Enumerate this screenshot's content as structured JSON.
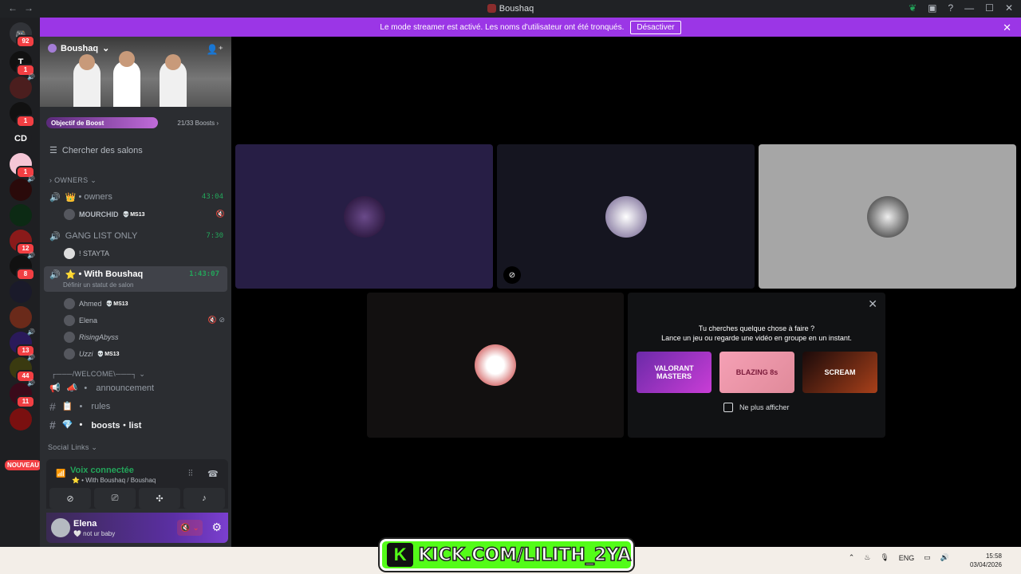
{
  "window": {
    "title": "Boushaq",
    "back": "←",
    "forward": "→"
  },
  "banner": {
    "text": "Le mode streamer est activé. Les noms d'utilisateur ont été tronqués.",
    "button": "Désactiver",
    "close": "✕"
  },
  "guilds": [
    {
      "label": "",
      "badge": "92"
    },
    {
      "label": "T",
      "badge": "1"
    },
    {
      "label": "",
      "badge": ""
    },
    {
      "label": "",
      "badge": "1"
    },
    {
      "label": "CD",
      "badge": ""
    },
    {
      "label": "",
      "badge": "1"
    },
    {
      "label": "",
      "badge": ""
    },
    {
      "label": "",
      "badge": ""
    },
    {
      "label": "",
      "badge": "12"
    },
    {
      "label": "",
      "badge": "8"
    },
    {
      "label": "",
      "badge": ""
    },
    {
      "label": "",
      "badge": ""
    },
    {
      "label": "",
      "badge": "13"
    },
    {
      "label": "",
      "badge": "44"
    },
    {
      "label": "",
      "badge": "11"
    },
    {
      "label": "",
      "badge": ""
    }
  ],
  "nouveau": "NOUVEAU",
  "server": {
    "name": "Boushaq"
  },
  "boost": {
    "goal": "Objectif de Boost",
    "count": "21/33 Boosts"
  },
  "search_channels": "Chercher des salons",
  "categories": {
    "owners": "OWNERS",
    "welcome": "┌───/WELCOME\\───┐",
    "social": "Social Links"
  },
  "voice_channels": [
    {
      "name": "owners",
      "emoji": "👑",
      "time": "43:04"
    },
    {
      "name": "GANG LIST ONLY",
      "emoji": "",
      "time": "7:30"
    },
    {
      "name": "With Boushaq",
      "emoji": "⭐",
      "time": "1:43:07",
      "status": "Définir un statut de salon"
    }
  ],
  "users": {
    "owners": [
      {
        "name": "MOURCHID",
        "tag": "MS13"
      }
    ],
    "gang": [
      {
        "name": "! STAYTA",
        "tag": ""
      }
    ],
    "with": [
      {
        "name": "Ahmed",
        "tag": "MS13"
      },
      {
        "name": "Elena",
        "tag": ""
      },
      {
        "name": "RisingAbyss",
        "tag": ""
      },
      {
        "name": "Uzzi",
        "tag": "MS13"
      }
    ]
  },
  "text_channels": [
    {
      "name": "announcement",
      "emoji": "📣"
    },
    {
      "name": "rules",
      "emoji": "📋"
    },
    {
      "name": "boosts・list",
      "emoji": "💎"
    }
  ],
  "voice_panel": {
    "title": "Voix connectée",
    "location": "With Boushaq / Boushaq"
  },
  "user": {
    "name": "Elena",
    "status": "🤍 not ur baby"
  },
  "activity": {
    "line1": "Tu cherches quelque chose à faire ?",
    "line2": "Lance un jeu ou regarde une vidéo en groupe en un instant.",
    "games": [
      "VALORANT MASTERS",
      "BLAZING 8s",
      "SCREAM"
    ],
    "dont_show": "Ne plus afficher"
  },
  "overlay": {
    "kick_url": "KICK.COM/LILITH_2YA",
    "kick_logo": "K"
  },
  "tray": {
    "lang": "ENG",
    "time": "15:58",
    "date": "03/04/2026"
  },
  "colors": {
    "accent": "#9b36e6",
    "green": "#23a55a",
    "kick": "#53fc18"
  }
}
